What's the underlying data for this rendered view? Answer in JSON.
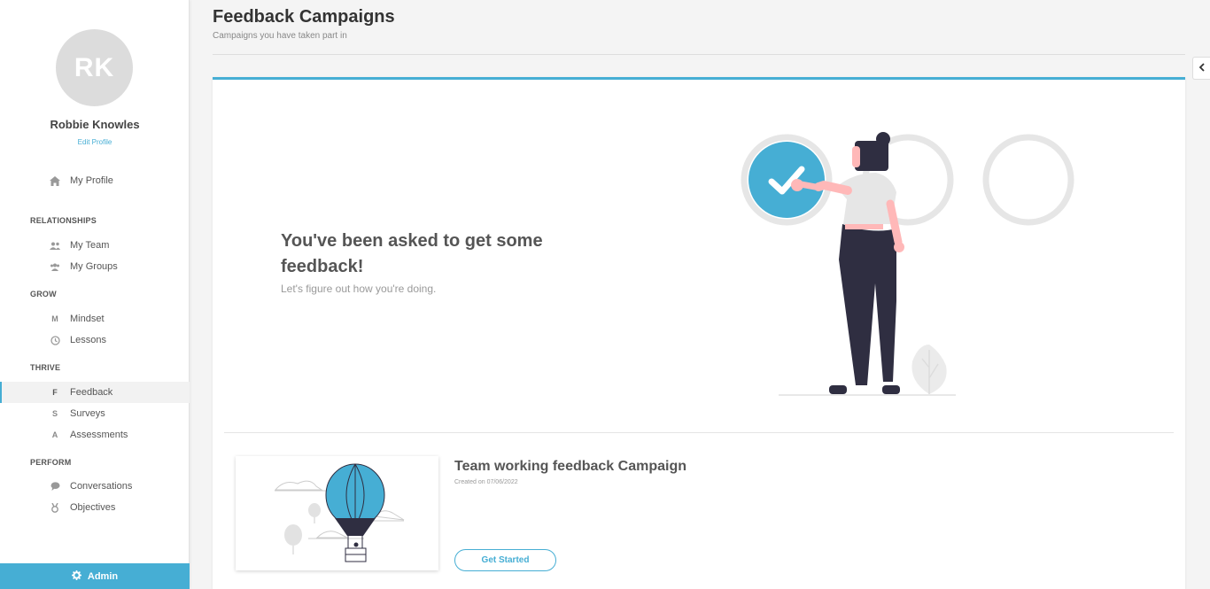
{
  "sidebar": {
    "avatar_initials": "RK",
    "user_name": "Robbie Knowles",
    "edit_profile": "Edit Profile",
    "my_profile": "My Profile",
    "sections": {
      "relationships": "RELATIONSHIPS",
      "grow": "GROW",
      "thrive": "THRIVE",
      "perform": "PERFORM"
    },
    "items": {
      "my_team": "My Team",
      "my_groups": "My Groups",
      "mindset": "Mindset",
      "lessons": "Lessons",
      "feedback": "Feedback",
      "surveys": "Surveys",
      "assessments": "Assessments",
      "conversations": "Conversations",
      "objectives": "Objectives"
    },
    "icon_glyphs": {
      "mindset": "M",
      "feedback": "F",
      "surveys": "S",
      "assessments": "A"
    },
    "admin": "Admin"
  },
  "header": {
    "title": "Feedback Campaigns",
    "subtitle": "Campaigns you have taken part in"
  },
  "hero": {
    "title": "You've been asked to get some feedback!",
    "subtitle": "Let's figure out how you're doing."
  },
  "campaign": {
    "title": "Team working feedback Campaign",
    "created": "Created on 07/06/2022",
    "button": "Get Started"
  },
  "colors": {
    "accent": "#46aed4",
    "sidebar_bg": "#ffffff",
    "page_bg": "#f4f4f4"
  }
}
